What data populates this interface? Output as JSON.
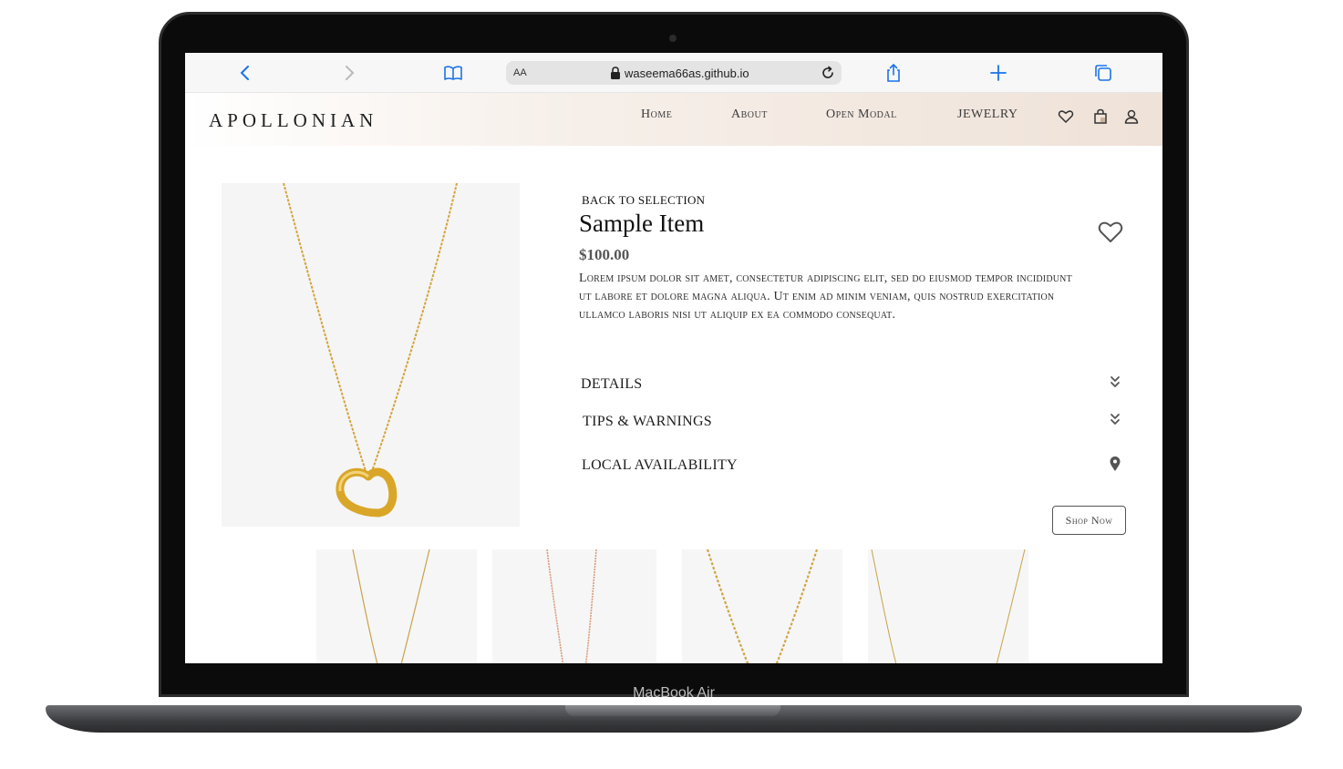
{
  "device": {
    "label": "MacBook Air"
  },
  "browser": {
    "text_size_label": "AA",
    "url": "waseema66as.github.io",
    "icons": [
      "back-icon",
      "forward-icon",
      "bookmarks-icon",
      "lock-icon",
      "reload-icon",
      "share-icon",
      "new-tab-icon",
      "tabs-icon"
    ]
  },
  "nav": {
    "brand": "APOLLONIAN",
    "links": [
      "Home",
      "About",
      "Open Modal",
      "JEWELRY"
    ],
    "icons": [
      "heart-icon",
      "shopping-bag-icon",
      "user-icon"
    ]
  },
  "product": {
    "back_link": "BACK TO SELECTION",
    "title": "Sample Item",
    "price": "$100.00",
    "description": "Lorem ipsum dolor sit amet, consectetur adipiscing elit, sed do eiusmod tempor incididunt ut labore et dolore magna aliqua. Ut enim ad minim veniam, quis nostrud exercitation ullamco laboris nisi ut aliquip ex ea commodo consequat.",
    "favorite_icon": "heart-outline-icon",
    "sections": [
      {
        "label": "DETAILS",
        "icon": "double-chevron-down-icon"
      },
      {
        "label": "TIPS & WARNINGS",
        "icon": "double-chevron-down-icon"
      },
      {
        "label": "LOCAL AVAILABILITY",
        "icon": "map-pin-icon"
      }
    ],
    "shop_button": "Shop Now"
  },
  "colors": {
    "accent_link": "#1a73e8",
    "gold": "#d4a43c",
    "rose_gold": "#d99b7c",
    "nav_gradient_end": "#efe2d8"
  }
}
